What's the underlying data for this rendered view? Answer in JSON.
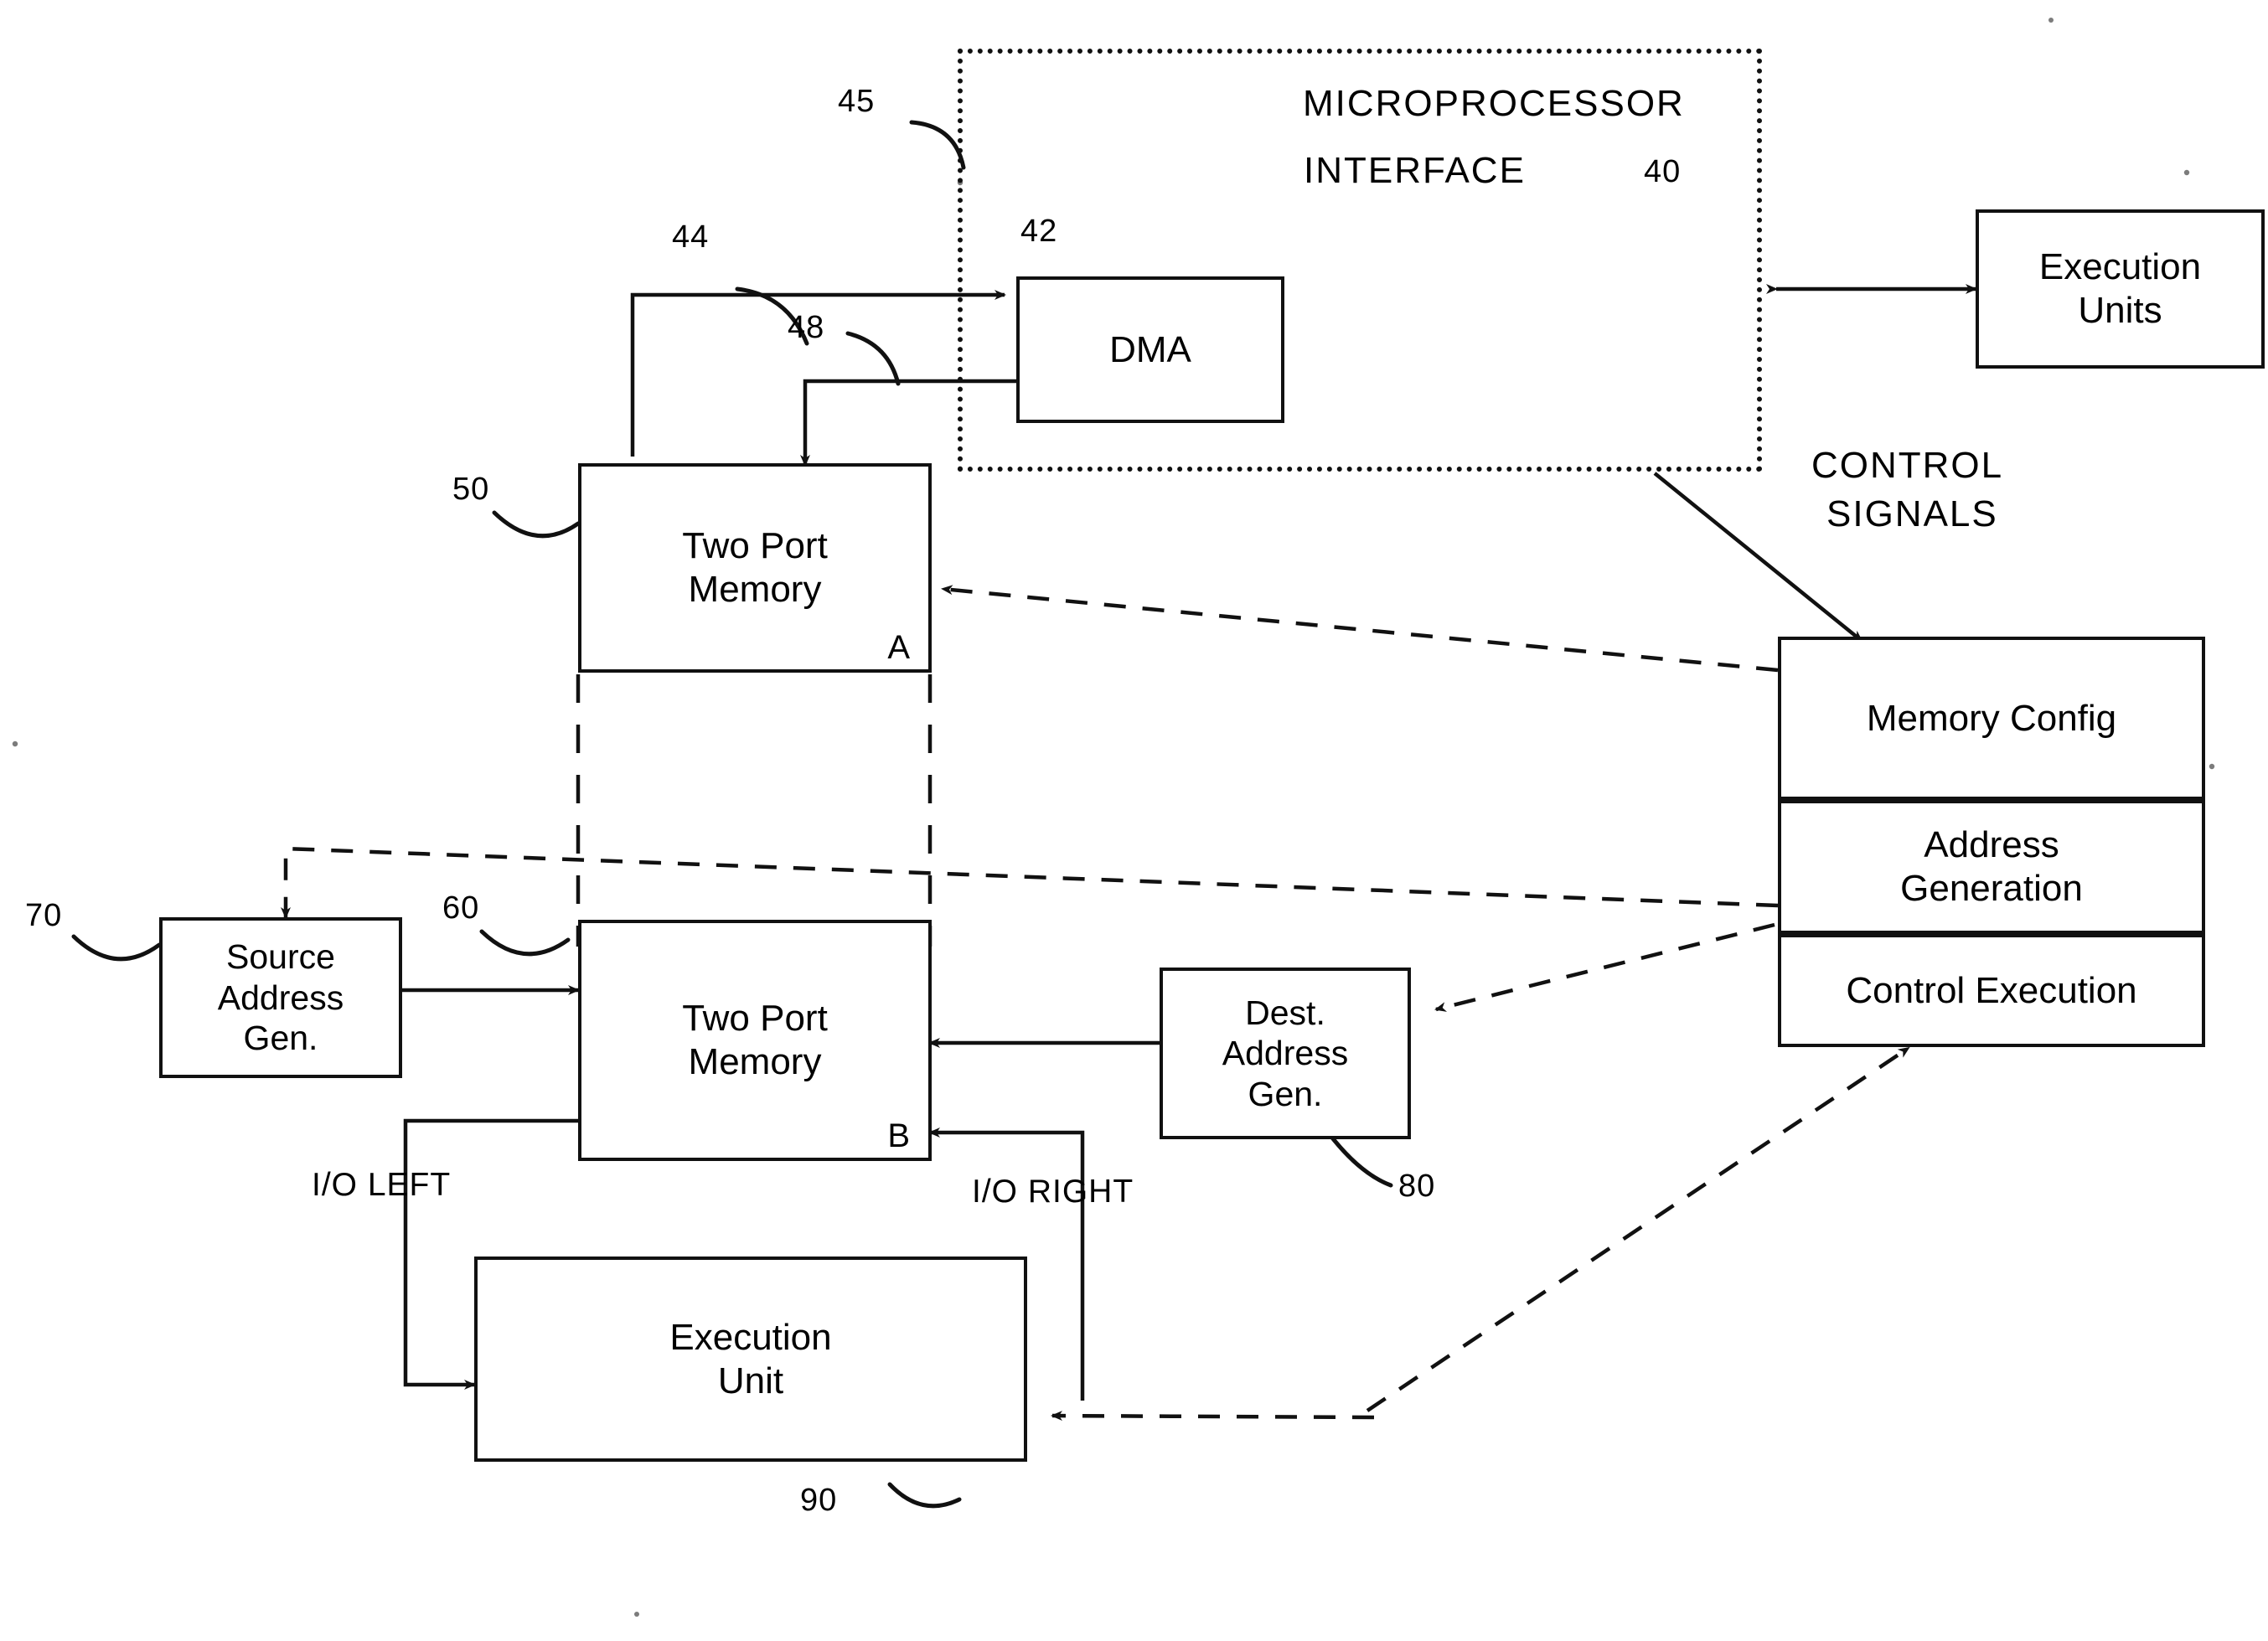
{
  "diagram": {
    "title_region": {
      "line1": "MICROPROCESSOR",
      "line2": "INTERFACE",
      "ref": "40",
      "region_ref": "45"
    },
    "boxes": [
      {
        "id": "dma",
        "lines": [
          "DMA"
        ],
        "ref": "42",
        "corner": ""
      },
      {
        "id": "exec_units",
        "lines": [
          "Execution",
          "Units"
        ],
        "ref": "",
        "corner": ""
      },
      {
        "id": "tpm_a",
        "lines": [
          "Two Port",
          "Memory"
        ],
        "ref": "50",
        "corner": "A"
      },
      {
        "id": "tpm_b",
        "lines": [
          "Two Port",
          "Memory"
        ],
        "ref": "60",
        "corner": "B"
      },
      {
        "id": "src_addr",
        "lines": [
          "Source",
          "Address",
          "Gen."
        ],
        "ref": "70",
        "corner": ""
      },
      {
        "id": "dest_addr",
        "lines": [
          "Dest.",
          "Address",
          "Gen."
        ],
        "ref": "80",
        "corner": ""
      },
      {
        "id": "exec_unit",
        "lines": [
          "Execution",
          "Unit"
        ],
        "ref": "90",
        "corner": ""
      },
      {
        "id": "mem_config",
        "lines": [
          "Memory Config"
        ],
        "ref": "",
        "corner": ""
      },
      {
        "id": "addr_gen",
        "lines": [
          "Address",
          "Generation"
        ],
        "ref": "",
        "corner": ""
      },
      {
        "id": "ctrl_exec",
        "lines": [
          "Control Execution"
        ],
        "ref": "",
        "corner": ""
      }
    ],
    "labels": {
      "control_signals_l1": "CONTROL",
      "control_signals_l2": "SIGNALS",
      "io_left": "I/O LEFT",
      "io_right": "I/O RIGHT"
    },
    "ref_numbers": {
      "r40": "40",
      "r42": "42",
      "r44": "44",
      "r45": "45",
      "r48": "48",
      "r50": "50",
      "r60": "60",
      "r70": "70",
      "r80": "80",
      "r90": "90"
    },
    "colors": {
      "ink": "#111111",
      "paper": "#ffffff"
    }
  }
}
